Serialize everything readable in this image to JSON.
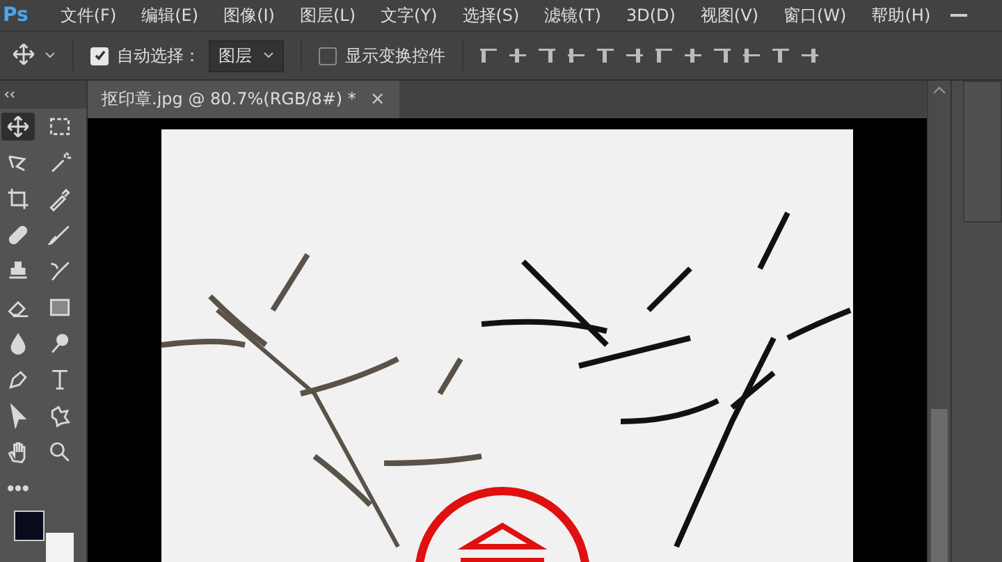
{
  "menubar": {
    "logo": "Ps",
    "items": [
      "文件(F)",
      "编辑(E)",
      "图像(I)",
      "图层(L)",
      "文字(Y)",
      "选择(S)",
      "滤镜(T)",
      "3D(D)",
      "视图(V)",
      "窗口(W)",
      "帮助(H)"
    ]
  },
  "options_bar": {
    "auto_select": {
      "checked": true,
      "label": "自动选择："
    },
    "layer_dropdown": {
      "value": "图层"
    },
    "show_transform": {
      "checked": false,
      "label": "显示变换控件"
    }
  },
  "document_tab": {
    "title": "抠印章.jpg @ 80.7%(RGB/8#) *",
    "close": "×"
  },
  "tools": [
    {
      "kind": "move",
      "selected": true
    },
    {
      "kind": "marquee",
      "selected": false
    },
    {
      "kind": "lasso",
      "selected": false
    },
    {
      "kind": "wand",
      "selected": false
    },
    {
      "kind": "crop",
      "selected": false
    },
    {
      "kind": "eyedropper",
      "selected": false
    },
    {
      "kind": "healing",
      "selected": false
    },
    {
      "kind": "brush",
      "selected": false
    },
    {
      "kind": "stamp",
      "selected": false
    },
    {
      "kind": "history",
      "selected": false
    },
    {
      "kind": "eraser",
      "selected": false
    },
    {
      "kind": "gradient",
      "selected": false
    },
    {
      "kind": "blur",
      "selected": false
    },
    {
      "kind": "dodge",
      "selected": false
    },
    {
      "kind": "pen",
      "selected": false
    },
    {
      "kind": "type",
      "selected": false
    },
    {
      "kind": "select",
      "selected": false
    },
    {
      "kind": "shape",
      "selected": false
    },
    {
      "kind": "hand",
      "selected": false
    },
    {
      "kind": "zoom",
      "selected": false
    },
    {
      "kind": "more",
      "selected": false
    }
  ]
}
